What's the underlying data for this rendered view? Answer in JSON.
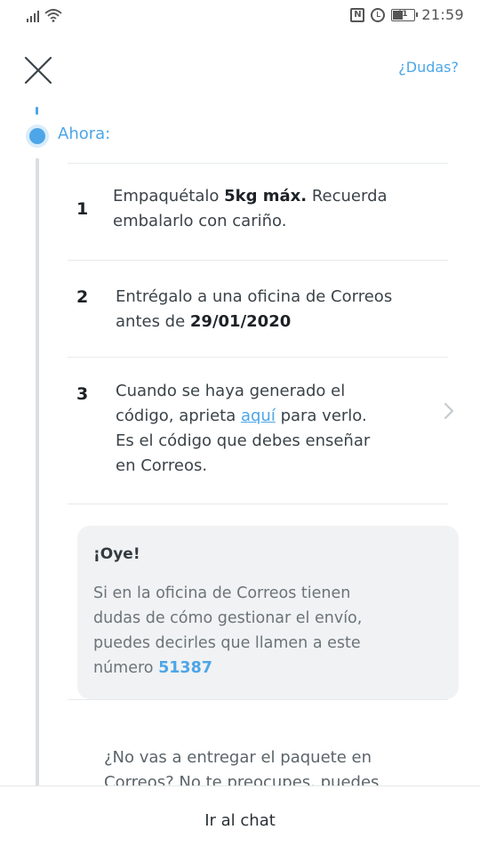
{
  "status_bar": {
    "battery": "41",
    "time": "21:59",
    "nfc_label": "N"
  },
  "header": {
    "help_link": "¿Dudas?"
  },
  "timeline": {
    "now_label": "Ahora:"
  },
  "steps": [
    {
      "number": "1"
    },
    {
      "number": "2"
    },
    {
      "number": "3"
    }
  ],
  "step1": {
    "prefix": "Empaquétalo ",
    "bold": "5kg máx.",
    "suffix_line1": " Recuerda",
    "line2": "embalarlo con cariño."
  },
  "step2": {
    "line1": "Entrégalo a una oficina de Correos",
    "line2_prefix": "antes de ",
    "date": "29/01/2020"
  },
  "step3": {
    "line1": "Cuando se haya generado el",
    "line2_prefix": "código, aprieta ",
    "link": "aquí",
    "line2_suffix": " para verlo.",
    "line3": "Es el código que debes enseñar",
    "line4": "en Correos."
  },
  "info_card": {
    "title": "¡Oye!",
    "line1": "Si en la oficina de Correos tienen",
    "line2": "dudas de cómo gestionar el envío,",
    "line3": "puedes decirles que llamen a este",
    "line4_prefix": "número ",
    "phone": "51387"
  },
  "footer_note": {
    "line1": "¿No vas a entregar el paquete en",
    "line2": "Correos? No te preocupes, puedes"
  },
  "bottom": {
    "chat_button": "Ir al chat"
  },
  "colors": {
    "accent": "#4da6e8",
    "timeline_track": "#dcdfe1",
    "card_bg": "#f1f2f3"
  }
}
